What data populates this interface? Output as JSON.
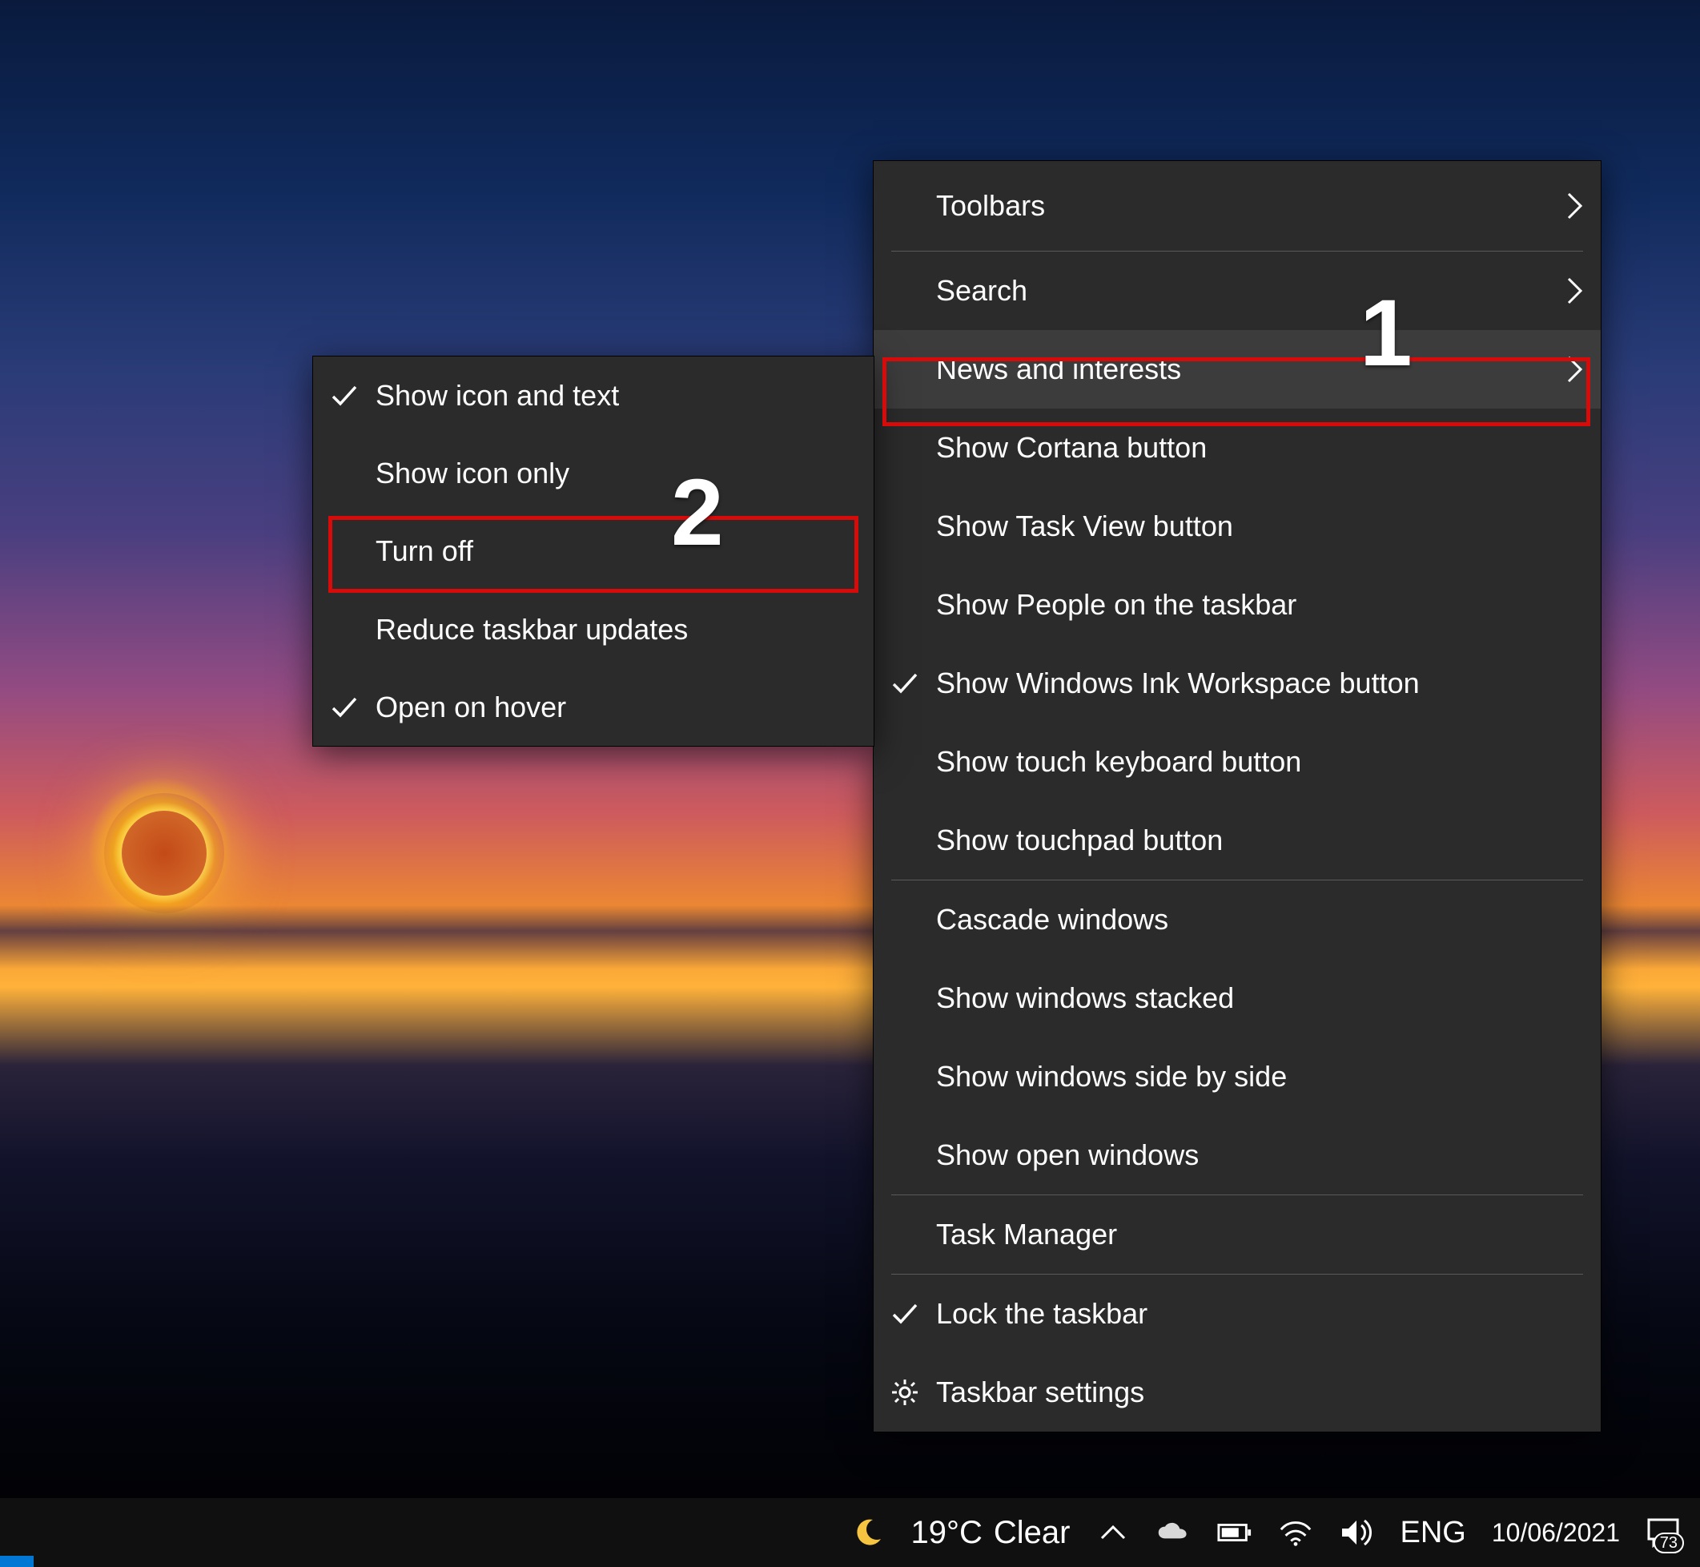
{
  "main_menu": {
    "toolbars": "Toolbars",
    "search": "Search",
    "news": "News and interests",
    "cortana": "Show Cortana button",
    "taskview": "Show Task View button",
    "people": "Show People on the taskbar",
    "ink": "Show Windows Ink Workspace button",
    "touchkb": "Show touch keyboard button",
    "touchpad": "Show touchpad button",
    "cascade": "Cascade windows",
    "stacked": "Show windows stacked",
    "sidebyside": "Show windows side by side",
    "openwin": "Show open windows",
    "taskmgr": "Task Manager",
    "lock": "Lock the taskbar",
    "settings": "Taskbar settings"
  },
  "sub_menu": {
    "icon_text": "Show icon and text",
    "icon_only": "Show icon only",
    "turn_off": "Turn off",
    "reduce": "Reduce taskbar updates",
    "hover": "Open on hover"
  },
  "annotations": {
    "n1": "1",
    "n2": "2"
  },
  "taskbar": {
    "temperature": "19°C",
    "condition": "Clear",
    "language": "ENG",
    "date": "10/06/2021",
    "notification_count": "73"
  }
}
